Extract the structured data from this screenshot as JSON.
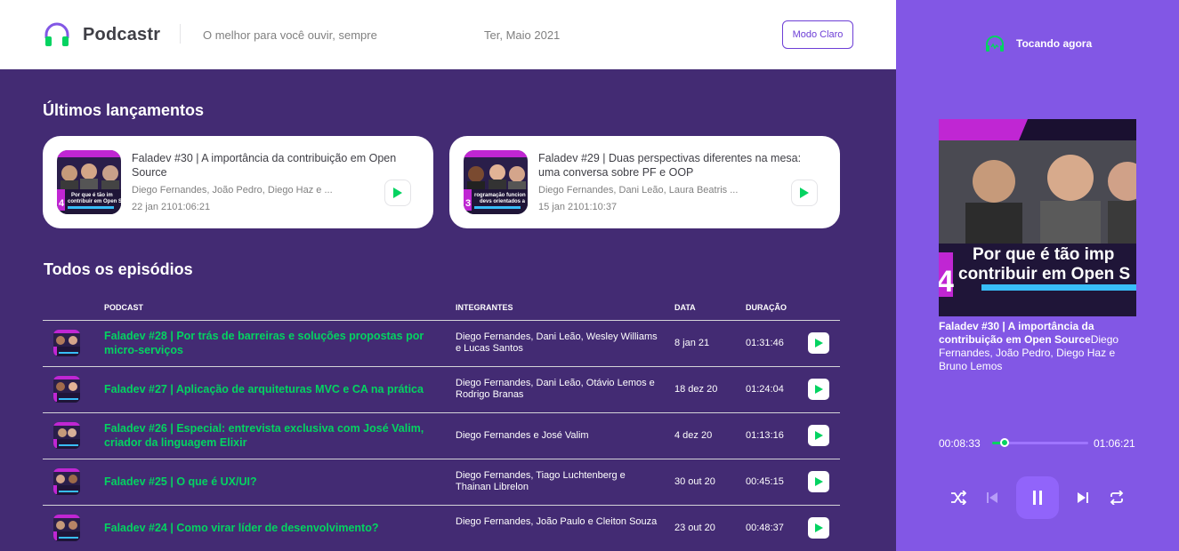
{
  "header": {
    "logo_text": "Podcastr",
    "tagline": "O melhor para você ouvir, sempre",
    "date": "Ter, Maio 2021",
    "mode_button": "Modo Claro"
  },
  "latest": {
    "title": "Últimos lançamentos",
    "episodes": [
      {
        "title": "Faladev #30 | A importância da contribuição em Open Source",
        "members": "Diego Fernandes, João Pedro, Diego Haz e ...",
        "date_duration": "22 jan 2101:06:21",
        "thumb_text": "Por que é tão imp contribuir em Open S"
      },
      {
        "title": "Faladev #29 | Duas perspectivas diferentes na mesa: uma conversa sobre PF e OOP",
        "members": "Diego Fernandes, Dani Leão, Laura Beatris ...",
        "date_duration": "15 jan 2101:10:37",
        "thumb_text": "Programação funcion devs orientados a o"
      }
    ]
  },
  "all": {
    "title": "Todos os episódios",
    "headers": {
      "podcast": "PODCAST",
      "members": "INTEGRANTES",
      "date": "DATA",
      "duration": "DURAÇÃO"
    },
    "rows": [
      {
        "title": "Faladev #28 | Por trás de barreiras e soluções propostas por micro-serviços",
        "members": "Diego Fernandes, Dani Leão, Wesley Williams e Lucas Santos",
        "date": "8 jan 21",
        "duration": "01:31:46"
      },
      {
        "title": "Faladev #27 | Aplicação de arquiteturas MVC e CA na prática",
        "members": "Diego Fernandes, Dani Leão, Otávio Lemos e Rodrigo Branas",
        "date": "18 dez 20",
        "duration": "01:24:04"
      },
      {
        "title": "Faladev #26 | Especial: entrevista exclusiva com José Valim, criador da linguagem Elixir",
        "members": "Diego Fernandes e José Valim",
        "date": "4 dez 20",
        "duration": "01:13:16"
      },
      {
        "title": "Faladev #25 | O que é UX/UI?",
        "members": "Diego Fernandes, Tiago Luchtenberg e Thainan Librelon",
        "date": "30 out 20",
        "duration": "00:45:15"
      },
      {
        "title": "Faladev #24 | Como virar líder de desenvolvimento?",
        "members": "Diego Fernandes, João Paulo e Cleiton Souza",
        "date": "23 out 20",
        "duration": "00:48:37"
      }
    ]
  },
  "player": {
    "now_playing": "Tocando agora",
    "cover_text_line1": "Por que é tão imp",
    "cover_text_line2": "contribuir em Open S",
    "cover_number": "4",
    "episode_title": "Faladev #30 | A importância da contribuição em Open Source",
    "episode_members": "Diego Fernandes, João Pedro, Diego Haz e Bruno Lemos",
    "current_time": "00:08:33",
    "total_time": "01:06:21",
    "progress": 0.129
  },
  "colors": {
    "purple_bg": "#432b73",
    "player_bg": "#8257e5",
    "green": "#04d361",
    "accent": "#6d3ed6"
  },
  "icons": [
    "headphones-logo-icon",
    "play-icon",
    "now-playing-icon",
    "shuffle-icon",
    "previous-icon",
    "pause-icon",
    "next-icon",
    "repeat-icon"
  ]
}
